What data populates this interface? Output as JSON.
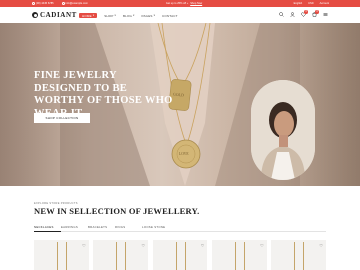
{
  "topbar": {
    "phone": "(00) 4445 6785",
    "email": "info@example.com",
    "promo_text": "Get up to 25% off +",
    "promo_link": "Shop Now",
    "right_items": [
      "English",
      "USD",
      "Account"
    ],
    "bg_color": "#e54c43"
  },
  "header": {
    "logo_text": "CADIANT",
    "nav": [
      {
        "label": "HOME",
        "active": true,
        "has_chevron": true
      },
      {
        "label": "SHOP",
        "active": false,
        "has_chevron": true
      },
      {
        "label": "BLOG",
        "active": false,
        "has_chevron": true
      },
      {
        "label": "PAGES",
        "active": false,
        "has_chevron": true
      },
      {
        "label": "CONTACT",
        "active": false,
        "has_chevron": false
      }
    ],
    "icons": [
      "search-icon",
      "user-icon",
      "heart-icon",
      "cart-icon",
      "menu-icon"
    ],
    "wishlist_count": "0",
    "cart_count": "0",
    "accent_color": "#e54c43"
  },
  "hero": {
    "title": "FINE JEWELRY DESIGNED TO BE WORTHY OF THOSE WHO WEAR IT",
    "button_label": "SHOP COLLECTION",
    "pendant_text_1": "GOLD",
    "pendant_text_2": "LOVE"
  },
  "section": {
    "subtitle": "EXPLORE STORE PRODUCTS",
    "title": "NEW IN SELLECTION OF JEWELLERY.",
    "tabs": [
      "NECKLACES",
      "EARRINGS",
      "BRACELETS",
      "RINGS",
      "LOOSE STONE"
    ],
    "active_tab": 0
  },
  "products": [
    {
      "name": "product-1"
    },
    {
      "name": "product-2"
    },
    {
      "name": "product-3"
    },
    {
      "name": "product-4"
    },
    {
      "name": "product-5"
    }
  ]
}
